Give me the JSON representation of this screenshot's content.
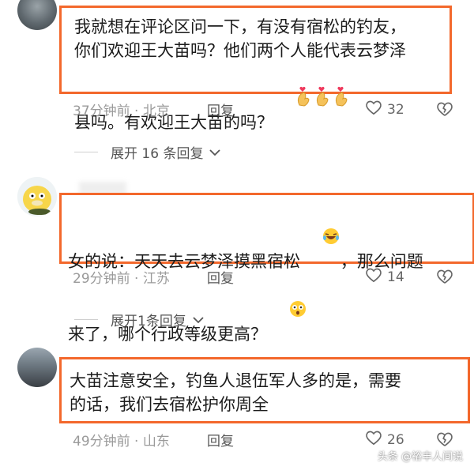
{
  "comments": [
    {
      "text": "我就想在评论区问一下，有没有宿松的钓友，\n你们欢迎王大苗吗？他们两个人能代表云梦泽\n县吗。有欢迎王大苗的吗？",
      "time_location": "37分钟前 · 北京",
      "reply_label": "回复",
      "likes": "32",
      "expand_label": "展开 16 条回复"
    },
    {
      "text_a": "女的说：天天去云梦泽摸黑宿松",
      "text_b": "，那么问题\n来了，哪个行政等级更高？",
      "time_location": "29分钟前 · 江苏",
      "reply_label": "回复",
      "likes": "14",
      "expand_label": "展开1条回复"
    },
    {
      "text": "大苗注意安全，钓鱼人退伍军人多的是，需要\n的话，我们去宿松护你周全",
      "time_location": "49分钟前 · 山东",
      "reply_label": "回复",
      "likes": "26"
    }
  ],
  "watermark": "头条 @裕丰人间说",
  "colors": {
    "highlight_border": "#f3682c",
    "meta_text": "#9a9a9a"
  }
}
